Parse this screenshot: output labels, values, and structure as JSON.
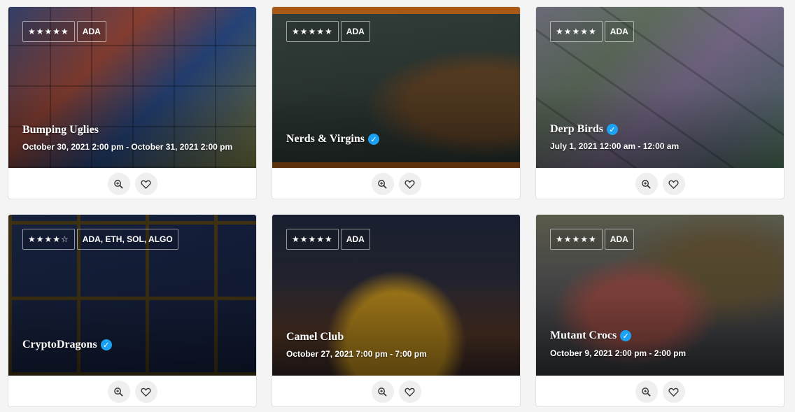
{
  "cards": [
    {
      "title": "Bumping Uglies",
      "date": "October 30, 2021 2:00 pm - October 31, 2021 2:00 pm",
      "stars": "★★★★★",
      "chain": "ADA",
      "verified": false,
      "image": "bumping-uglies-artwork"
    },
    {
      "title": "Nerds & Virgins",
      "date": "",
      "stars": "★★★★★",
      "chain": "ADA",
      "verified": true,
      "image": "nerds-and-virgins-artwork"
    },
    {
      "title": "Derp Birds",
      "date": "July 1, 2021 12:00 am - 12:00 am",
      "stars": "★★★★★",
      "chain": "ADA",
      "verified": true,
      "image": "derp-birds-artwork"
    },
    {
      "title": "CryptoDragons",
      "date": "",
      "stars": "★★★★☆",
      "chain": "ADA, ETH, SOL, ALGO",
      "verified": true,
      "image": "cryptodragons-artwork"
    },
    {
      "title": "Camel Club",
      "date": "October 27, 2021 7:00 pm - 7:00 pm",
      "stars": "★★★★★",
      "chain": "ADA",
      "verified": false,
      "image": "camel-club-artwork"
    },
    {
      "title": "Mutant Crocs",
      "date": "October 9, 2021 2:00 pm - 2:00 pm",
      "stars": "★★★★★",
      "chain": "ADA",
      "verified": true,
      "image": "mutant-crocs-artwork"
    }
  ],
  "actions": {
    "zoom_icon": "zoom-in-icon",
    "favorite_icon": "heart-icon"
  },
  "colors": {
    "verified": "#1da1f2",
    "page_background": "#f4f4f4",
    "card_background": "#ffffff",
    "action_button": "#efefef"
  }
}
